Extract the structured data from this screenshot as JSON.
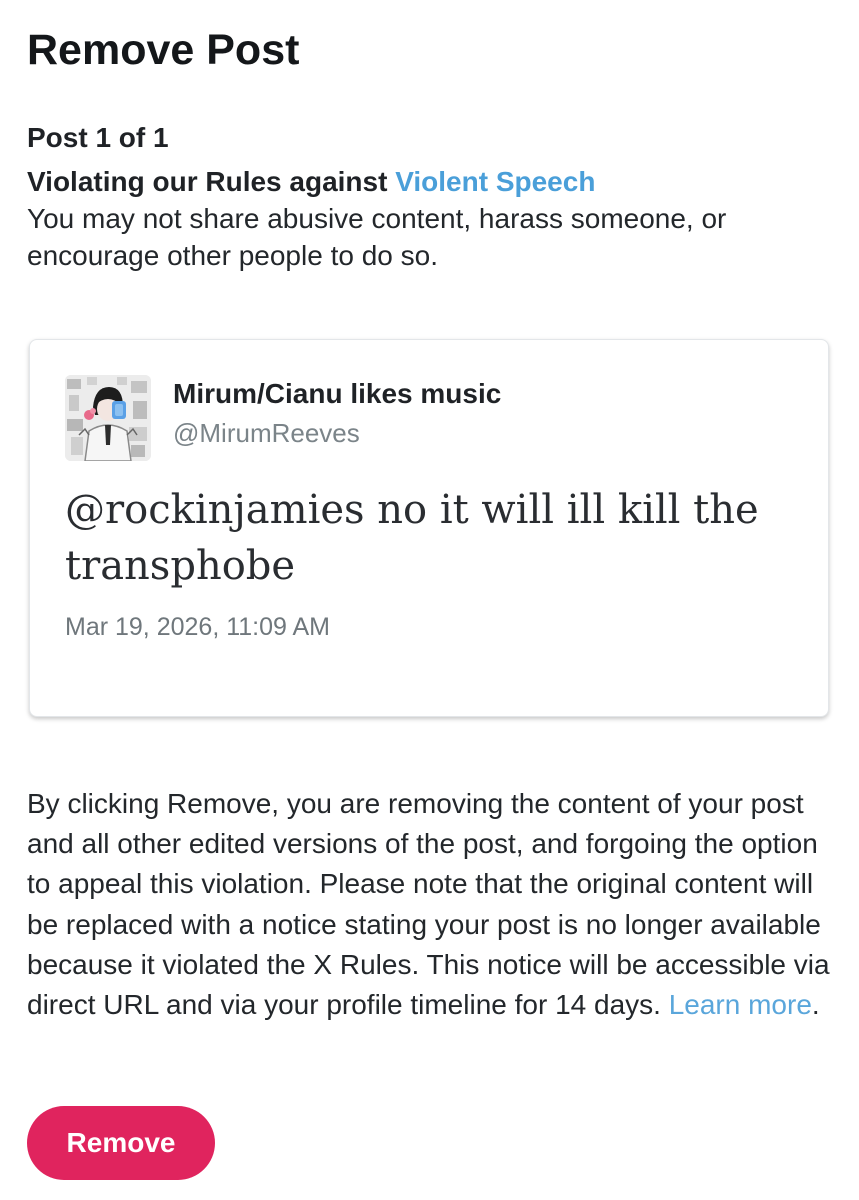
{
  "page": {
    "title": "Remove Post"
  },
  "violation": {
    "post_counter": "Post 1 of 1",
    "rule_prefix": "Violating our Rules against ",
    "policy_name": "Violent Speech",
    "policy_description": "You may not share abusive content, harass someone, or encourage other people to do so."
  },
  "post": {
    "author_name": "Mirum/Cianu likes music",
    "author_handle": "@MirumReeves",
    "text": "@rockinjamies no it will ill kill the transphobe",
    "timestamp": "Mar 19, 2026, 11:09 AM"
  },
  "notice": {
    "body": "By clicking Remove, you are removing the content of your post and all other edited versions of the post, and forgoing the option to appeal this violation. Please note that the original content will be replaced with a notice stating your post is no longer available because it violated the X Rules. This notice will be accessible via direct URL and via your profile timeline for 14 days. ",
    "learn_more_label": "Learn more",
    "trailing_punct": "."
  },
  "actions": {
    "remove_label": "Remove"
  },
  "colors": {
    "link": "#4a9fd9",
    "danger_button": "#e0245e",
    "muted_text": "#7b8489"
  }
}
